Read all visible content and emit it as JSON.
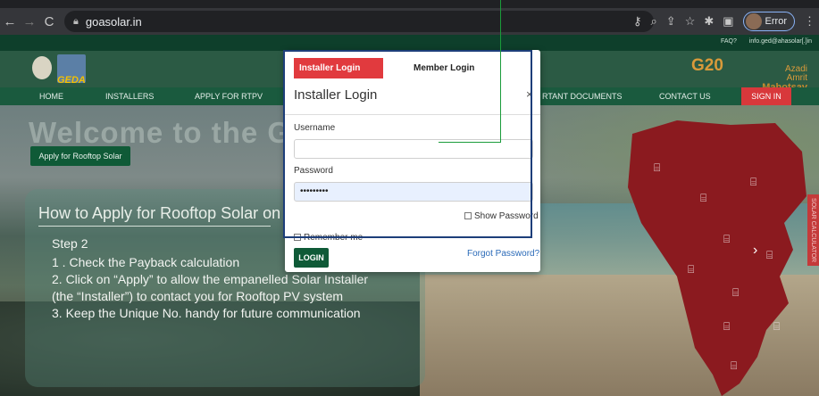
{
  "browser": {
    "url": "goasolar.in",
    "profile_label": "Error"
  },
  "site": {
    "top_links": [
      "FAQ?",
      "info.ged@ahasolar[.]in"
    ],
    "logo_text": "GEDA",
    "g20_text": "G20",
    "azadi_line1": "Azadi",
    "azadi_line2": "Amrit",
    "azadi_line3": "Mahotsav",
    "nav": [
      "HOME",
      "INSTALLERS",
      "APPLY FOR RTPV",
      "RTANT DOCUMENTS",
      "CONTACT US"
    ],
    "sign_in": "SIGN IN"
  },
  "hero": {
    "welcome": "Welcome to the Goa So",
    "apply_button": "Apply for Rooftop Solar",
    "how_title": "How to Apply for Rooftop Solar on",
    "steps": [
      "Step 2",
      "1 . Check the Payback calculation",
      "2. Click on “Apply” to allow the empanelled Solar Installer",
      "(the “Installer”) to contact you for Rooftop PV  system",
      "3. Keep the Unique No. handy for future communication"
    ],
    "side_tab": "SOLAR CALCULATOR"
  },
  "modal": {
    "tab_installer": "Installer Login",
    "tab_member": "Member Login",
    "title": "Installer Login",
    "close": "×",
    "username_label": "Username",
    "username_value": "",
    "password_label": "Password",
    "password_value": "•••••••••",
    "show_password": "Show Password",
    "remember_me": "Remember me",
    "login_button": "LOGIN",
    "forgot_password": "Forgot Password?"
  },
  "colors": {
    "brand_green": "#0f5a37",
    "login_tab_red": "#e13a3e",
    "highlight_box": "#1d3e7a",
    "pointer_line": "#1a9c3a",
    "map_red": "#8b1a1f"
  }
}
